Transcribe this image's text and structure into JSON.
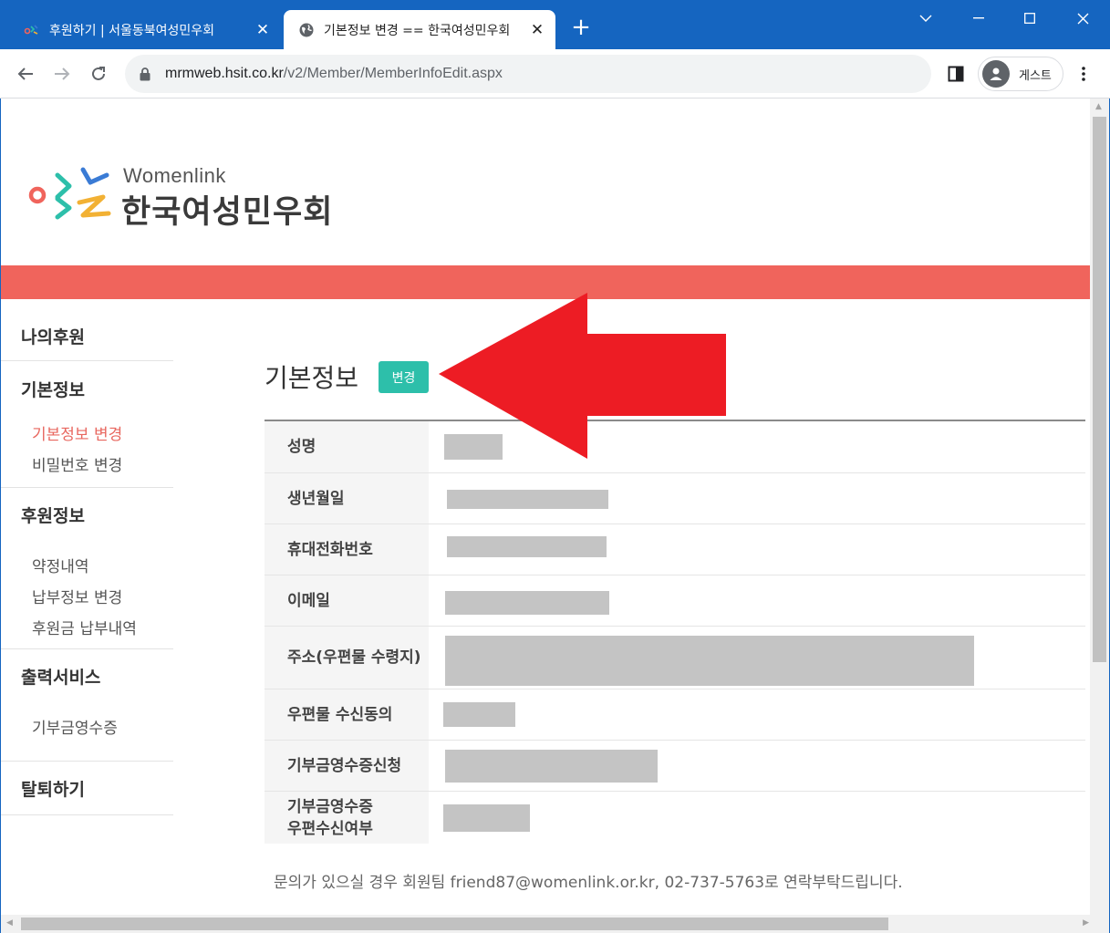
{
  "browser": {
    "tabs": [
      {
        "title": "후원하기 | 서울동북여성민우회",
        "active": false
      },
      {
        "title": "기본정보 변경 == 한국여성민우회",
        "active": true
      }
    ],
    "url_host": "mrmweb.hsit.co.kr",
    "url_path": "/v2/Member/MemberInfoEdit.aspx",
    "profile_label": "게스트"
  },
  "site": {
    "brand_en": "Womenlink",
    "brand_ko": "한국여성민우회",
    "brand_color": "#f0645c",
    "accent_color": "#2dbfaa"
  },
  "sidebar": {
    "my_support": "나의후원",
    "basic_info": "기본정보",
    "basic_info_items": [
      "기본정보 변경",
      "비밀번호 변경"
    ],
    "support_info": "후원정보",
    "support_info_items": [
      "약정내역",
      "납부정보 변경",
      "후원금 납부내역"
    ],
    "print_service": "출력서비스",
    "print_service_items": [
      "기부금영수증"
    ],
    "withdraw": "탈퇴하기"
  },
  "main": {
    "title": "기본정보",
    "change_button": "변경",
    "rows": [
      {
        "label": "성명"
      },
      {
        "label": "생년월일"
      },
      {
        "label": "휴대전화번호"
      },
      {
        "label": "이메일"
      },
      {
        "label": "주소(우편물 수령지)"
      },
      {
        "label": "우편물 수신동의"
      },
      {
        "label": "기부금영수증신청"
      },
      {
        "label_line1": "기부금영수증",
        "label_line2": "우편수신여부"
      }
    ],
    "footer_note": "문의가 있으실 경우 회원팀 friend87@womenlink.or.kr, 02-737-5763로 연락부탁드립니다."
  }
}
